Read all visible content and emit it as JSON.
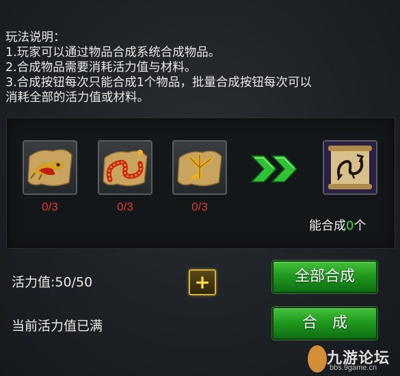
{
  "instructions": {
    "title": "玩法说明：",
    "line1": "1.玩家可以通过物品合成系统合成物品。",
    "line2": "2.合成物品需要消耗活力值与材料。",
    "line3a": "3.合成按钮每次只能合成1个物品，批量合成按钮每次可以",
    "line3b": "消耗全部的活力值或材料。"
  },
  "materials": [
    {
      "icon": "dragon-head-scroll-icon",
      "count": "0/3"
    },
    {
      "icon": "dragon-body-scroll-icon",
      "count": "0/3"
    },
    {
      "icon": "dragon-claw-scroll-icon",
      "count": "0/3"
    }
  ],
  "result": {
    "icon": "dragon-emblem-scroll-icon"
  },
  "can_make": {
    "prefix": "能合成",
    "num": "0",
    "suffix": "个"
  },
  "vitality": {
    "label": "活力值:50/50",
    "status": "当前活力值已满"
  },
  "buttons": {
    "plus": "+",
    "craft_all": "全部合成",
    "craft": "合　成"
  },
  "watermark": {
    "text": "九游论坛",
    "url": "bbs.9game.cn"
  },
  "colors": {
    "count_red": "#e23a2a",
    "count_green": "#3fe04a",
    "button_green": "#229a20",
    "plus_gold": "#d8b13a"
  }
}
